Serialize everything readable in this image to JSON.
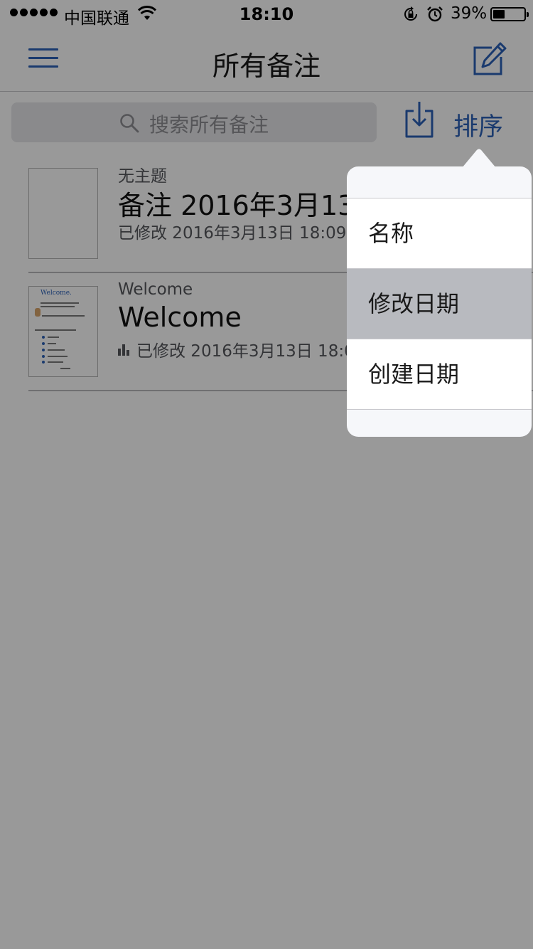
{
  "status_bar": {
    "carrier": "中国联通",
    "time": "18:10",
    "battery_percent": "39%",
    "battery_level": 0.39,
    "icons": [
      "signal-dots",
      "wifi-icon",
      "rotation-lock-icon",
      "alarm-icon",
      "battery-icon"
    ]
  },
  "navbar": {
    "title": "所有备注",
    "left_icon": "menu-icon",
    "right_icon": "compose-icon"
  },
  "toolbar": {
    "search_placeholder": "搜索所有备注",
    "import_icon": "import-icon",
    "sort_label": "排序"
  },
  "notes": [
    {
      "subtitle": "无主题",
      "title": "备注 2016年3月13",
      "meta": "已修改 2016年3月13日 18:09",
      "has_chart_icon": false
    },
    {
      "subtitle": "Welcome",
      "title": "Welcome",
      "meta": "已修改 2016年3月13日 18:0",
      "has_chart_icon": true,
      "thumbnail_heading": "Welcome."
    }
  ],
  "sort_menu": {
    "options": [
      "名称",
      "修改日期",
      "创建日期"
    ],
    "selected": "修改日期"
  },
  "colors": {
    "accent": "#2c62b8",
    "overlay": "rgba(0,0,0,0.4)",
    "selected_row": "#b8babf"
  }
}
